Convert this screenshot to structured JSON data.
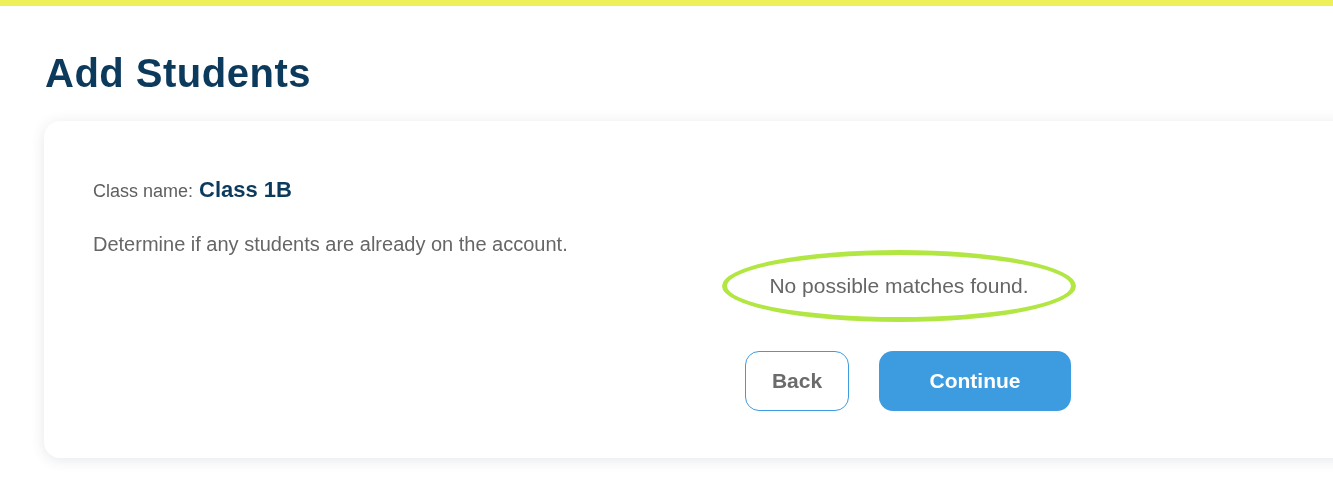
{
  "page_title": "Add Students",
  "class_name": {
    "label": "Class name:",
    "value": "Class 1B"
  },
  "instruction": "Determine if any students are already on the account.",
  "result_message": "No possible matches found.",
  "buttons": [
    {
      "label": "Back",
      "kind": "secondary"
    },
    {
      "label": "Continue",
      "kind": "primary"
    }
  ]
}
